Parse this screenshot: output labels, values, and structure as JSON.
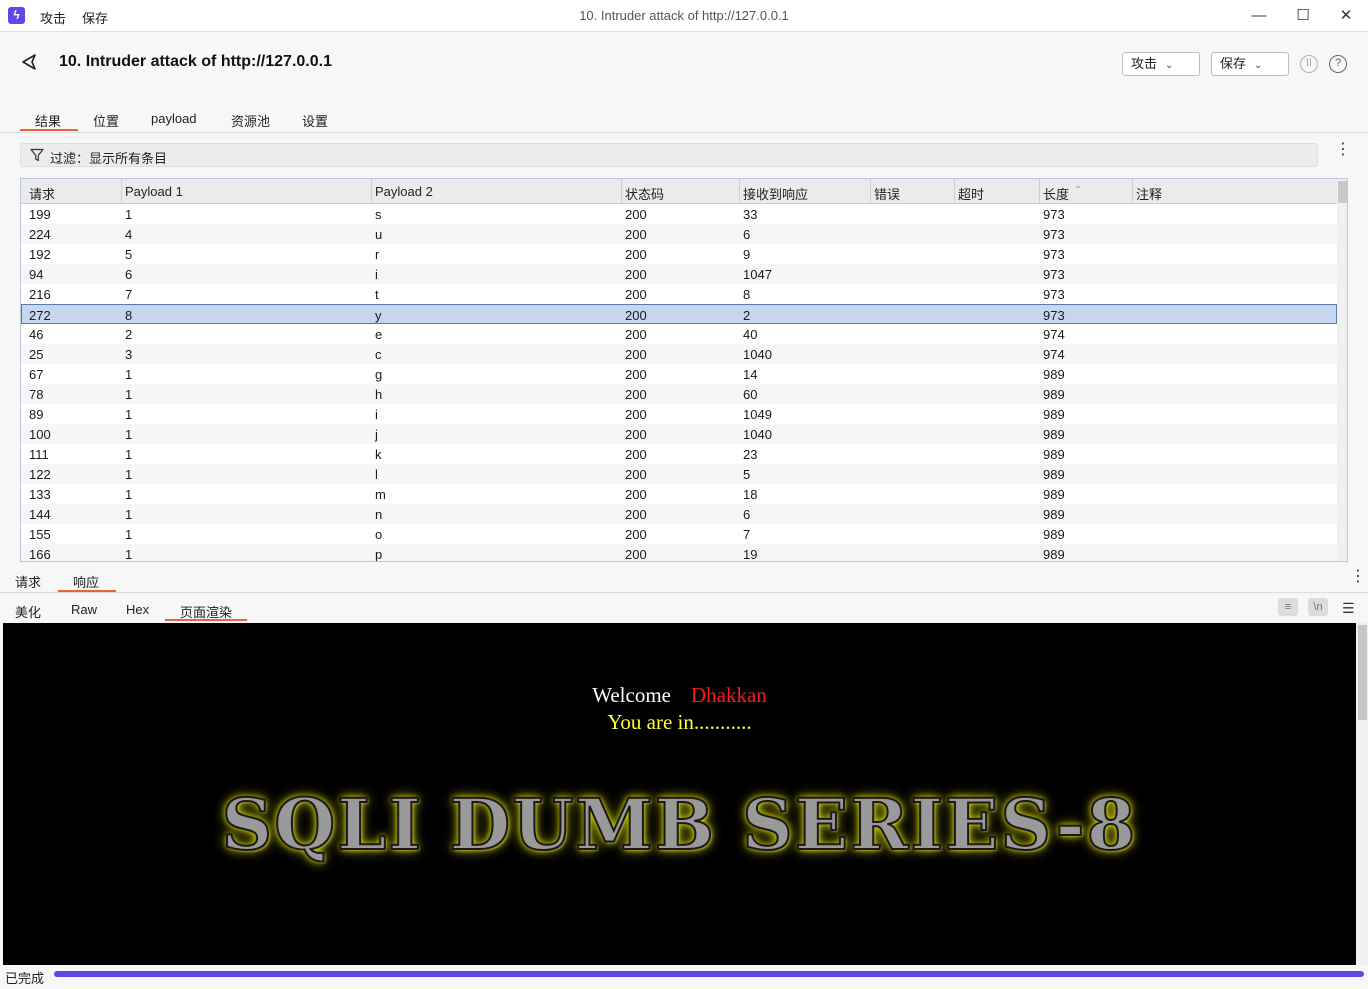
{
  "titlebar": {
    "menu": [
      "攻击",
      "保存"
    ],
    "window_title": "10. Intruder attack of http://127.0.0.1"
  },
  "header": {
    "title": "10. Intruder attack of http://127.0.0.1",
    "attack_button": "攻击",
    "save_button": "保存",
    "tabs": [
      "结果",
      "位置",
      "payload",
      "资源池",
      "设置"
    ]
  },
  "filter": {
    "text": "过滤：显示所有条目"
  },
  "table": {
    "columns": [
      "请求",
      "Payload 1",
      "Payload 2",
      "状态码",
      "接收到响应",
      "错误",
      "超时",
      "长度",
      "注释"
    ],
    "rows": [
      [
        "199",
        "1",
        "s",
        "200",
        "33",
        "",
        "",
        "973",
        ""
      ],
      [
        "224",
        "4",
        "u",
        "200",
        "6",
        "",
        "",
        "973",
        ""
      ],
      [
        "192",
        "5",
        "r",
        "200",
        "9",
        "",
        "",
        "973",
        ""
      ],
      [
        "94",
        "6",
        "i",
        "200",
        "1047",
        "",
        "",
        "973",
        ""
      ],
      [
        "216",
        "7",
        "t",
        "200",
        "8",
        "",
        "",
        "973",
        ""
      ],
      [
        "272",
        "8",
        "y",
        "200",
        "2",
        "",
        "",
        "973",
        ""
      ],
      [
        "46",
        "2",
        "e",
        "200",
        "40",
        "",
        "",
        "974",
        ""
      ],
      [
        "25",
        "3",
        "c",
        "200",
        "1040",
        "",
        "",
        "974",
        ""
      ],
      [
        "67",
        "1",
        "g",
        "200",
        "14",
        "",
        "",
        "989",
        ""
      ],
      [
        "78",
        "1",
        "h",
        "200",
        "60",
        "",
        "",
        "989",
        ""
      ],
      [
        "89",
        "1",
        "i",
        "200",
        "1049",
        "",
        "",
        "989",
        ""
      ],
      [
        "100",
        "1",
        "j",
        "200",
        "1040",
        "",
        "",
        "989",
        ""
      ],
      [
        "111",
        "1",
        "k",
        "200",
        "23",
        "",
        "",
        "989",
        ""
      ],
      [
        "122",
        "1",
        "l",
        "200",
        "5",
        "",
        "",
        "989",
        ""
      ],
      [
        "133",
        "1",
        "m",
        "200",
        "18",
        "",
        "",
        "989",
        ""
      ],
      [
        "144",
        "1",
        "n",
        "200",
        "6",
        "",
        "",
        "989",
        ""
      ],
      [
        "155",
        "1",
        "o",
        "200",
        "7",
        "",
        "",
        "989",
        ""
      ],
      [
        "166",
        "1",
        "p",
        "200",
        "19",
        "",
        "",
        "989",
        ""
      ]
    ],
    "selected_row": 5
  },
  "lower": {
    "tabs": [
      "请求",
      "响应"
    ],
    "active_tab": "响应",
    "view_tabs": [
      "美化",
      "Raw",
      "Hex",
      "页面渲染"
    ],
    "active_view": "页面渲染"
  },
  "render": {
    "welcome": "Welcome",
    "name": "Dhakkan",
    "you_are_in": "You are in...........",
    "banner": "SQLI DUMB SERIES-8"
  },
  "status": {
    "text": "已完成",
    "progress": 1.0
  },
  "colors": {
    "accent": "#e8643a",
    "brand": "#5b4ae6",
    "selected_row": "#c5d6ee"
  }
}
